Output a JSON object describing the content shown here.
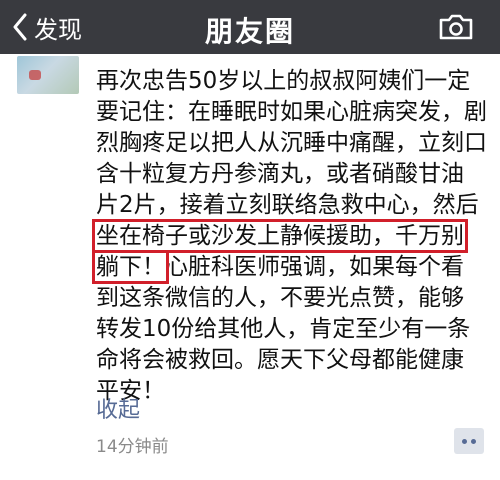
{
  "header": {
    "back_label": "发现",
    "title": "朋友圈",
    "camera_icon": "camera-icon"
  },
  "post": {
    "lines": [
      "再次忠告50岁以上的叔叔阿姨们一定",
      "要记住：在睡眠时如果心脏病突发，剧",
      "烈胸疼足以把人从沉睡中痛醒，立刻口",
      "含十粒复方丹参滴丸，或者硝酸甘油",
      "片2片，接着立刻联络急救中心，然后"
    ],
    "line6_highlight": "坐在椅子或沙发上静候援助，千万别",
    "line7_highlight": "躺下！",
    "line7_rest": "心脏科医师强调，如果每个看",
    "lines_after": [
      "到这条微信的人，不要光点赞，能够",
      "转发10份给其他人，肯定至少有一条",
      "命将会被救回。愿天下父母都能健康",
      "平安！"
    ],
    "collapse_label": "收起",
    "timestamp": "14分钟前"
  },
  "colors": {
    "header_bg": "#393a3f",
    "link": "#576b95",
    "highlight_border": "#d11f2a"
  }
}
